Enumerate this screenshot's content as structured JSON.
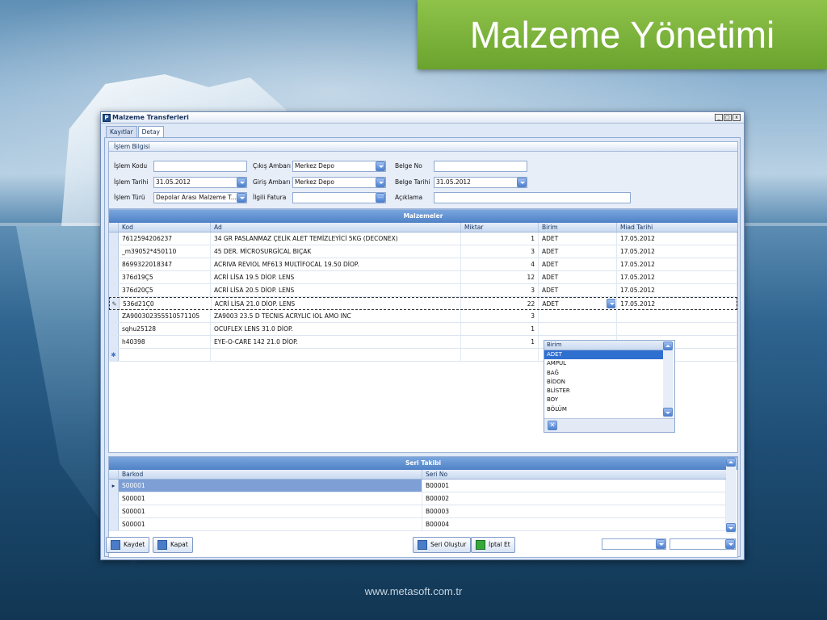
{
  "slide": {
    "title": "Malzeme Yönetimi",
    "footer_url": "www.metasoft.com.tr"
  },
  "window": {
    "title": "Malzeme Transferleri",
    "app_icon_letter": "P",
    "min_label": "_",
    "max_label": "□",
    "close_label": "x"
  },
  "tabs": [
    {
      "label": "Kayıtlar"
    },
    {
      "label": "Detay"
    }
  ],
  "form": {
    "group_title": "İşlem Bilgisi",
    "islem_kodu_label": "İşlem Kodu",
    "islem_kodu_value": "",
    "islem_tarihi_label": "İşlem Tarihi",
    "islem_tarihi_value": "31.05.2012",
    "islem_turu_label": "İşlem Türü",
    "islem_turu_value": "Depolar Arası Malzeme T...",
    "cikis_ambari_label": "Çıkış Ambarı",
    "cikis_ambari_value": "Merkez Depo",
    "giris_ambari_label": "Giriş Ambarı",
    "giris_ambari_value": "Merkez Depo",
    "ilgili_fatura_label": "İlgili Fatura",
    "ilgili_fatura_value": "",
    "belge_no_label": "Belge No",
    "belge_no_value": "",
    "belge_tarihi_label": "Belge Tarihi",
    "belge_tarihi_value": "31.05.2012",
    "aciklama_label": "Açıklama",
    "aciklama_value": "",
    "ellipsis": "..."
  },
  "malzemeler": {
    "title": "Malzemeler",
    "columns": [
      "Kod",
      "Ad",
      "Miktar",
      "Birim",
      "Miad Tarihi"
    ],
    "rows": [
      {
        "kod": "7612594206237",
        "ad": "34 GR PASLANMAZ ÇELİK ALET TEMİZLEYİCİ 5KG (DECONEX)",
        "miktar": "1",
        "birim": "ADET",
        "miad": "17.05.2012"
      },
      {
        "kod": "_m39052*450110",
        "ad": "45 DER. MİCROSURGİCAL BIÇAK",
        "miktar": "3",
        "birim": "ADET",
        "miad": "17.05.2012"
      },
      {
        "kod": "8699322018347",
        "ad": "ACRIVA REVIOL MF613 MULTİFOCAL 19.50 DİOP.",
        "miktar": "4",
        "birim": "ADET",
        "miad": "17.05.2012"
      },
      {
        "kod": "376d19Ç5",
        "ad": "ACRİ LİSA 19.5 DİOP. LENS",
        "miktar": "12",
        "birim": "ADET",
        "miad": "17.05.2012"
      },
      {
        "kod": "376d20Ç5",
        "ad": "ACRİ LİSA 20.5 DİOP. LENS",
        "miktar": "3",
        "birim": "ADET",
        "miad": "17.05.2012"
      },
      {
        "kod": "536d21Ç0",
        "ad": "ACRİ LİSA 21.0 DİOP. LENS",
        "miktar": "22",
        "birim": "ADET",
        "miad": "17.05.2012"
      },
      {
        "kod": "ZA900302355510571105",
        "ad": "ZA9003 23.5 D TECNIS ACRYLIC IOL AMO INC",
        "miktar": "3",
        "birim": "",
        "miad": ""
      },
      {
        "kod": "sqhu25128",
        "ad": "OCUFLEX LENS 31.0 DİOP.",
        "miktar": "1",
        "birim": "",
        "miad": ""
      },
      {
        "kod": "h40398",
        "ad": "EYE-O-CARE 142 21.0 DİOP.",
        "miktar": "1",
        "birim": "",
        "miad": ""
      }
    ],
    "edit_indicator": "✎",
    "new_indicator": "✱"
  },
  "birim_dropdown": {
    "header": "Birim",
    "items": [
      "ADET",
      "AMPUL",
      "BAĞ",
      "BİDON",
      "BLİSTER",
      "BOY",
      "BÖLÜM"
    ],
    "selected": "ADET",
    "close_label": "✕"
  },
  "seri_takibi": {
    "title": "Seri Takibi",
    "columns": [
      "Barkod",
      "Seri No"
    ],
    "rows": [
      {
        "barkod": "S00001",
        "seri": "B00001"
      },
      {
        "barkod": "S00001",
        "seri": "B00002"
      },
      {
        "barkod": "S00001",
        "seri": "B00003"
      },
      {
        "barkod": "S00001",
        "seri": "B00004"
      }
    ],
    "current_indicator": "▸"
  },
  "buttons": {
    "kaydet": "Kaydet",
    "kapat": "Kapat",
    "seri_olustur": "Seri Oluştur",
    "iptal_et": "İptal Et"
  },
  "colors": {
    "title_bg": "#6aa32e",
    "header_blue": "#4f81c6",
    "selection": "#2f6fd0"
  }
}
